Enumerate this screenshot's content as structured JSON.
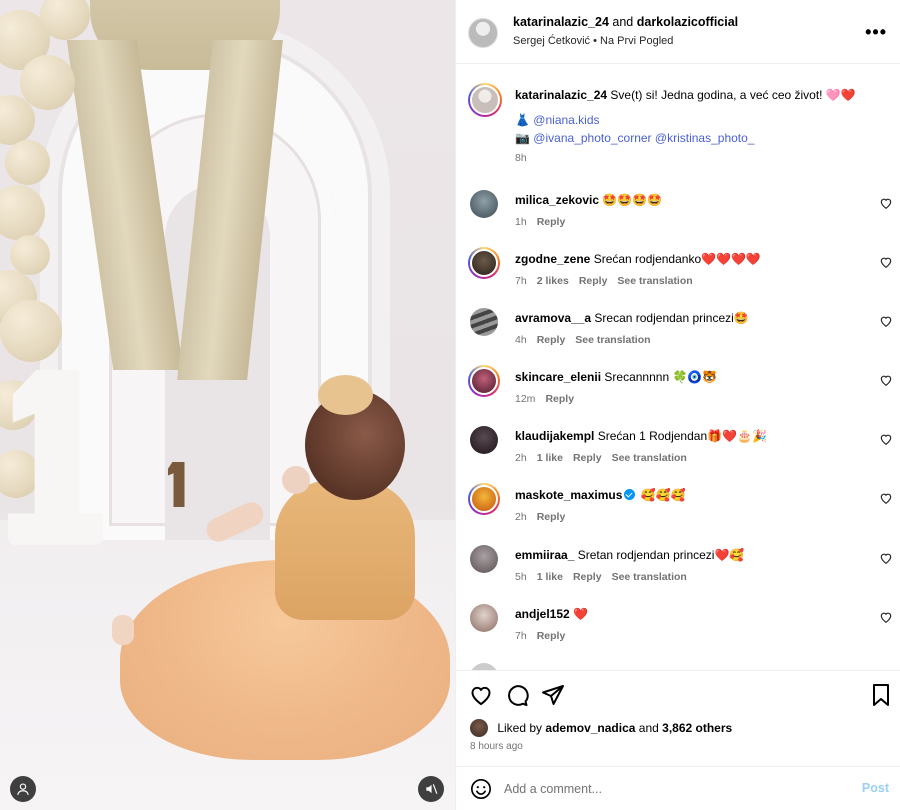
{
  "header": {
    "user1": "katarinalazic_24",
    "and_text": "and",
    "user2": "darkolazicofficial",
    "audio": "Sergej Ćetković",
    "separator": "•",
    "track": "Na Prvi Pogled",
    "more": "•••"
  },
  "caption": {
    "username": "katarinalazic_24",
    "text": "Sve(t) si! Jedna godina, a već ceo život! 🩷❤️",
    "line2_emoji": "👗",
    "mention1": "@niana.kids",
    "line3_emoji": "📷",
    "mention2": "@ivana_photo_corner",
    "mention3": "@kristinas_photo_",
    "time": "8h"
  },
  "comments": [
    {
      "username": "milica_zekovic",
      "text": "🤩🤩🤩🤩",
      "time": "1h",
      "likes": "",
      "reply": "Reply",
      "translate": ""
    },
    {
      "username": "zgodne_zene",
      "text": "Srećan rodjendanko❤️❤️❤️❤️",
      "time": "7h",
      "likes": "2 likes",
      "reply": "Reply",
      "translate": "See translation"
    },
    {
      "username": "avramova__a",
      "text": "Srecan rodjendan princezi🤩",
      "time": "4h",
      "likes": "",
      "reply": "Reply",
      "translate": "See translation"
    },
    {
      "username": "skincare_elenii",
      "text": "Srecannnnn 🍀🧿🐯",
      "time": "12m",
      "likes": "",
      "reply": "Reply",
      "translate": ""
    },
    {
      "username": "klaudijakempl",
      "text": "Srećan 1 Rodjendan🎁❤️🎂🎉",
      "time": "2h",
      "likes": "1 like",
      "reply": "Reply",
      "translate": "See translation"
    },
    {
      "username": "maskote_maximus",
      "text": "🥰🥰🥰",
      "time": "2h",
      "likes": "",
      "reply": "Reply",
      "translate": ""
    },
    {
      "username": "emmiiraa_",
      "text": "Sretan rodjendan princezi❤️🥰",
      "time": "5h",
      "likes": "1 like",
      "reply": "Reply",
      "translate": "See translation"
    },
    {
      "username": "andjel152",
      "text": "❤️",
      "time": "7h",
      "likes": "",
      "reply": "Reply",
      "translate": ""
    }
  ],
  "likes": {
    "prefix": "Liked by",
    "user": "ademov_nadica",
    "and": "and",
    "count": "3,862 others"
  },
  "posted": "8 hours ago",
  "add_comment": {
    "placeholder": "Add a comment...",
    "post": "Post"
  },
  "icons": {
    "like": "heart-icon",
    "comment": "comment-icon",
    "share": "share-icon",
    "save": "bookmark-icon",
    "emoji": "emoji-icon",
    "more": "more-icon",
    "mute": "mute-icon",
    "tagged": "user-icon"
  },
  "colors": {
    "link": "#4a5fd1",
    "verified": "#0095f6",
    "post_button": "#9ad0f5"
  }
}
